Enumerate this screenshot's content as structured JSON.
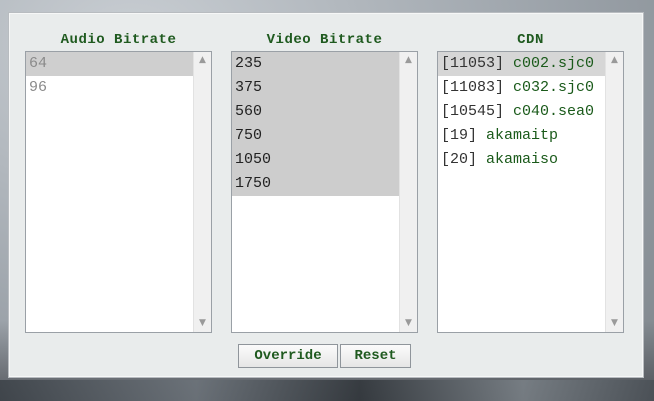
{
  "audio": {
    "title": "Audio Bitrate",
    "items": [
      "64",
      "96"
    ]
  },
  "video": {
    "title": "Video Bitrate",
    "items": [
      "235",
      "375",
      "560",
      "750",
      "1050",
      "1750"
    ]
  },
  "cdn": {
    "title": "CDN",
    "items": [
      {
        "id": "[11053]",
        "host": "c002.sjc0"
      },
      {
        "id": "[11083]",
        "host": "c032.sjc0"
      },
      {
        "id": "[10545]",
        "host": "c040.sea0"
      },
      {
        "id": "[19]",
        "host": "akamaitp"
      },
      {
        "id": "[20]",
        "host": "akamaiso"
      }
    ]
  },
  "buttons": {
    "override": "Override",
    "reset": "Reset"
  },
  "icons": {
    "scroll_up": "triangle-up-icon",
    "scroll_down": "triangle-down-icon"
  }
}
